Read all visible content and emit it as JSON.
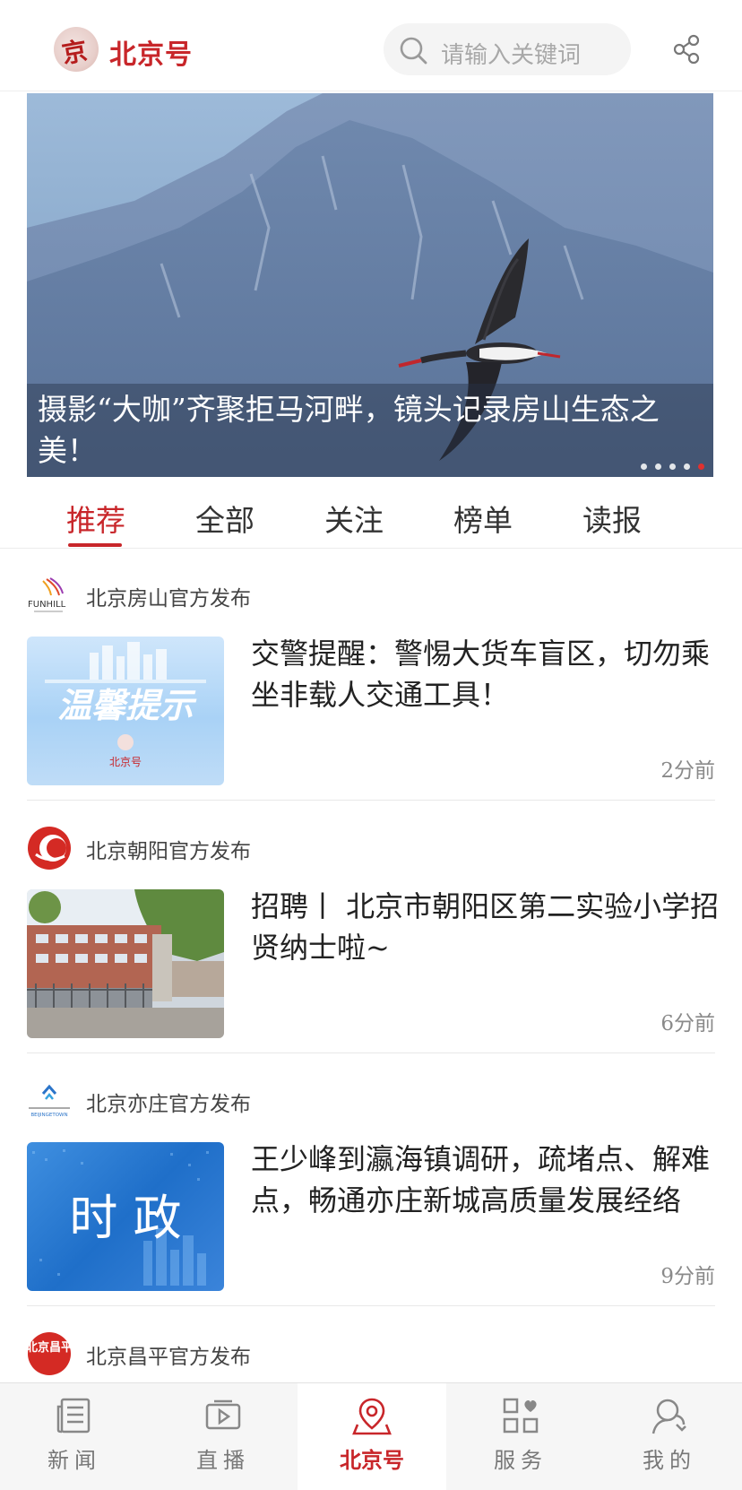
{
  "header": {
    "logo_char": "京",
    "app_title": "北京号",
    "search_placeholder": "请输入关键词"
  },
  "banner": {
    "caption": "摄影“大咖”齐聚拒马河畔，镜头记录房山生态之美！",
    "slide_count": 5,
    "active_slide": 5
  },
  "tabs": [
    {
      "label": "推荐",
      "active": true
    },
    {
      "label": "全部",
      "active": false
    },
    {
      "label": "关注",
      "active": false
    },
    {
      "label": "榜单",
      "active": false
    },
    {
      "label": "读报",
      "active": false
    }
  ],
  "feed": [
    {
      "source": "北京房山官方发布",
      "source_logo_text": "FUNHILL",
      "headline": "交警提醒：警惕大货车盲区，切勿乘坐非载人交通工具！",
      "time": "2分前",
      "thumb_text": "温馨提示",
      "thumb_sub": "北京号"
    },
    {
      "source": "北京朝阳官方发布",
      "headline": "招聘丨 北京市朝阳区第二实验小学招贤纳士啦~",
      "time": "6分前"
    },
    {
      "source": "北京亦庄官方发布",
      "source_logo_text": "BEIJINGETOWN",
      "headline": "王少峰到瀛海镇调研，疏堵点、解难点，畅通亦庄新城高质量发展经络",
      "time": "9分前",
      "thumb_text": "时 政"
    },
    {
      "source": "北京昌平官方发布",
      "source_logo_text": "北京昌平"
    }
  ],
  "bottom_nav": [
    {
      "label": "新闻",
      "icon": "newspaper-icon",
      "active": false
    },
    {
      "label": "直播",
      "icon": "video-icon",
      "active": false
    },
    {
      "label": "北京号",
      "icon": "location-pin-icon",
      "active": true
    },
    {
      "label": "服务",
      "icon": "grid-heart-icon",
      "active": false
    },
    {
      "label": "我的",
      "icon": "user-icon",
      "active": false
    }
  ],
  "colors": {
    "brand_red": "#c8262a",
    "text_dark": "#222222",
    "time_gray": "#8a8a8a"
  }
}
